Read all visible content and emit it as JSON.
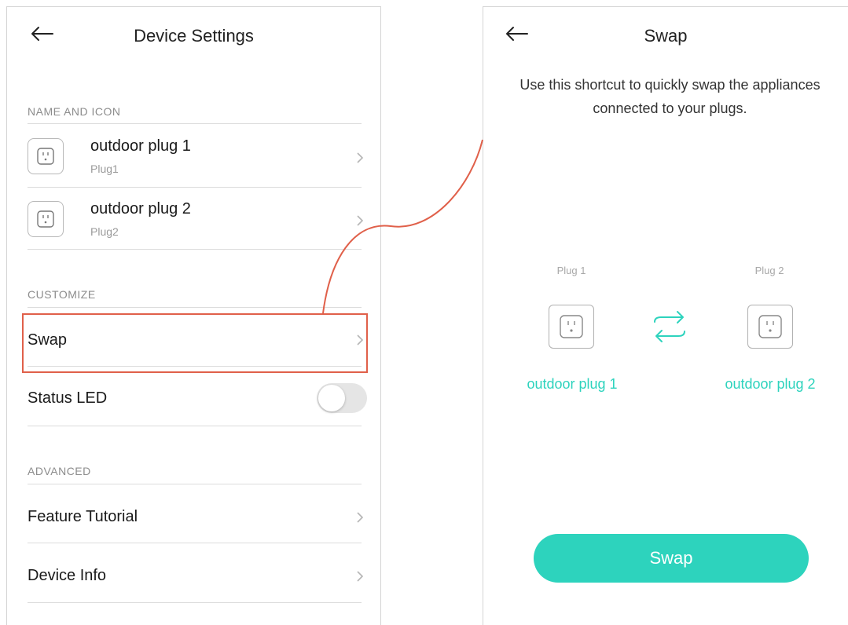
{
  "left": {
    "title": "Device Settings",
    "sections": {
      "name_and_icon": "NAME AND ICON",
      "customize": "CUSTOMIZE",
      "advanced": "ADVANCED"
    },
    "devices": [
      {
        "name": "outdoor plug 1",
        "sub": "Plug1"
      },
      {
        "name": "outdoor plug 2",
        "sub": "Plug2"
      }
    ],
    "rows": {
      "swap": "Swap",
      "status_led": "Status LED",
      "feature_tutorial": "Feature Tutorial",
      "device_info": "Device Info"
    },
    "status_led_on": false
  },
  "right": {
    "title": "Swap",
    "description": "Use this shortcut to quickly swap the appliances connected to your plugs.",
    "plug1_label": "Plug 1",
    "plug2_label": "Plug 2",
    "plug1_name": "outdoor plug 1",
    "plug2_name": "outdoor plug 2",
    "button": "Swap"
  },
  "colors": {
    "accent": "#2dd3bd",
    "highlight": "#e0604a"
  },
  "icons": {
    "back": "back-arrow-icon",
    "chevron": "chevron-right-icon",
    "plug": "outlet-icon",
    "swap": "swap-arrows-icon"
  }
}
